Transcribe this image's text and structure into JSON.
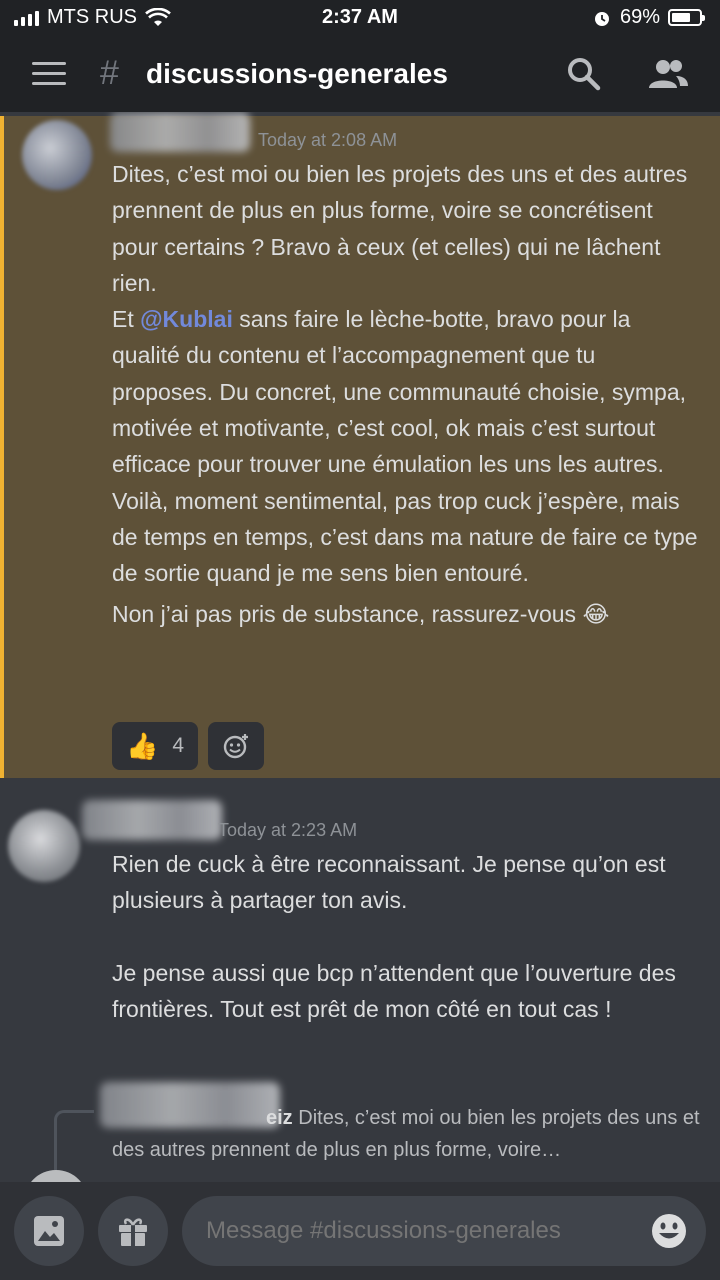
{
  "status_bar": {
    "carrier": "MTS RUS",
    "time": "2:37 AM",
    "battery": "69%",
    "battery_level": 0.69
  },
  "header": {
    "channel_prefix": "#",
    "channel_name": "discussions-generales"
  },
  "messages": [
    {
      "timestamp": "Today at 2:08 AM",
      "paragraphs": [
        "Dites, c’est moi ou bien les projets des uns et des autres prennent de plus en plus forme, voire se concrétisent pour certains ? Bravo à ceux (et celles) qui ne lâchent rien."
      ],
      "mention_prefix": "Et",
      "mention": "@Kublai",
      "mention_suffix": "sans faire le lèche-botte, bravo pour la qualité du contenu et l’accompagnement que tu proposes. Du concret, une communauté choisie, sympa, motivée et motivante, c’est cool, ok mais c’est surtout efficace pour trouver une émulation les uns les autres.",
      "paragraph_after": "Voilà, moment sentimental, pas trop cuck j’espère, mais de temps en temps, c’est dans ma nature de faire ce type de sortie quand je me sens bien entouré.",
      "last_line": "Non j’ai pas pris de substance, rassurez-vous 😂",
      "reaction_emoji": "👍",
      "reaction_count": "4"
    },
    {
      "timestamp": "Today at 2:23 AM",
      "paragraph1": "Rien de cuck à être reconnaissant. Je pense qu’on est plusieurs à partager ton avis.",
      "paragraph2": "Je pense aussi que bcp n’attendent que l’ouverture des frontières. Tout est prêt de mon côté en tout cas !"
    }
  ],
  "reply_preview": {
    "author_fragment": "eiz",
    "text": "Dites, c’est moi ou bien les projets des uns et des autres prennent de plus en plus forme, voire…"
  },
  "composer": {
    "placeholder": "Message #discussions-generales"
  },
  "icons": {
    "menu": "hamburger-menu-icon",
    "search": "search-icon",
    "members": "members-icon",
    "image": "image-icon",
    "gift": "gift-icon",
    "emoji": "emoji-icon",
    "add_reaction": "add-reaction-icon"
  }
}
